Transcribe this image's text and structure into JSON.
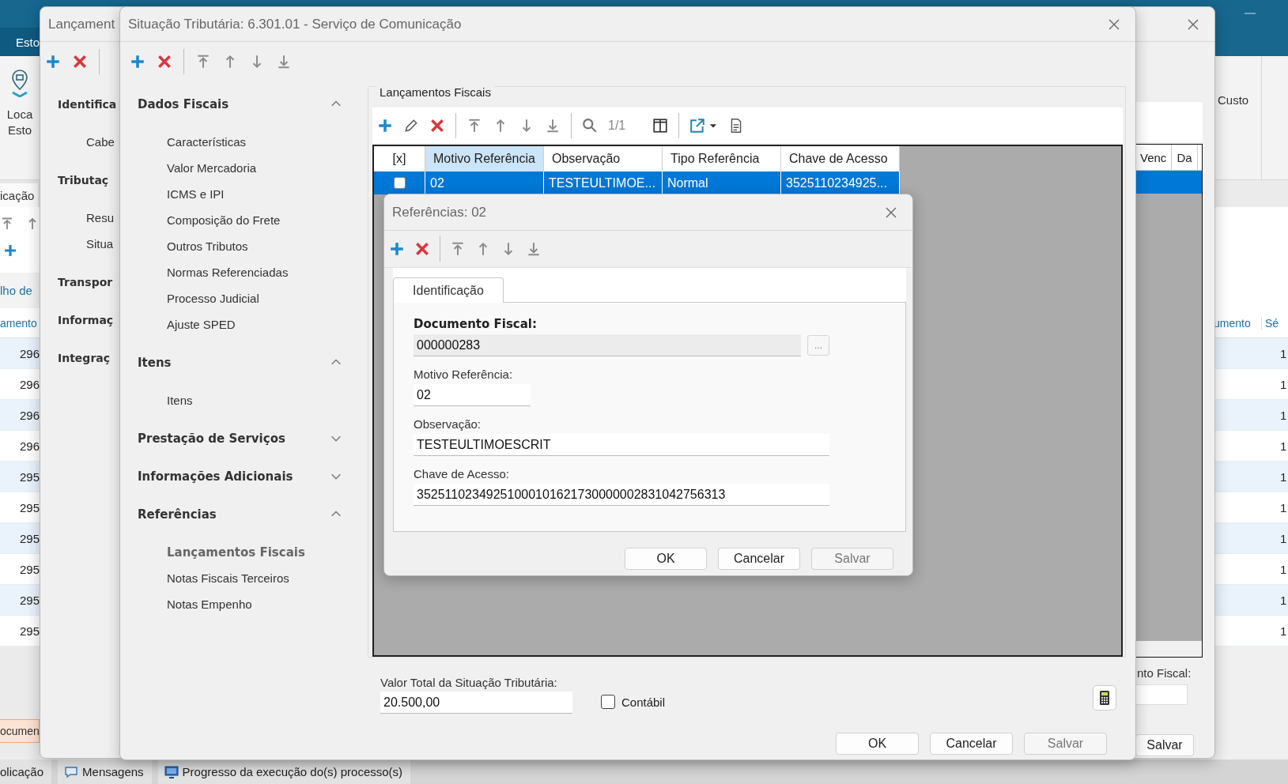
{
  "background_app": {
    "ribbon_tab": "Esto",
    "ribbon_button_lines": [
      "Loca",
      "Esto"
    ],
    "ribbon_right_label": "Custo",
    "left_tab": "icação",
    "left_link": "lho de",
    "left_column_header": "amento",
    "left_rows": [
      "296",
      "296",
      "296",
      "296",
      "295",
      "295",
      "295",
      "295",
      "295",
      "295"
    ],
    "left_badge": "ocumen",
    "right_column_headers": [
      "umento",
      "Sé"
    ],
    "right_rows": [
      "1",
      "1",
      "1",
      "1",
      "1",
      "1",
      "1",
      "1",
      "1",
      "1"
    ]
  },
  "window_back": {
    "title": "Lançament",
    "nav": [
      {
        "kind": "section",
        "label": "Identifica"
      },
      {
        "kind": "item",
        "label": "Cabe"
      },
      {
        "kind": "section",
        "label": "Tributaç"
      },
      {
        "kind": "item",
        "label": "Resu"
      },
      {
        "kind": "item",
        "label": "Situa"
      },
      {
        "kind": "section",
        "label": "Transpor"
      },
      {
        "kind": "section",
        "label": "Informaç"
      },
      {
        "kind": "section",
        "label": "Integraç"
      }
    ],
    "grid_columns": [
      "Venc",
      "Da"
    ],
    "grid_row": {
      "selected": true
    },
    "field_label": "nto Fiscal:",
    "button": "Salvar"
  },
  "window_main": {
    "title": "Situação Tributária: 6.301.01 - Serviço de Comunicação",
    "nav": [
      {
        "label": "Dados Fiscais",
        "expanded": true,
        "items": [
          {
            "label": "Características",
            "selected": false
          },
          {
            "label": "Valor Mercadoria",
            "selected": false
          },
          {
            "label": "ICMS e IPI",
            "selected": false
          },
          {
            "label": "Composição do Frete",
            "selected": false
          },
          {
            "label": "Outros Tributos",
            "selected": false
          },
          {
            "label": "Normas Referenciadas",
            "selected": false
          },
          {
            "label": "Processo Judicial",
            "selected": false
          },
          {
            "label": "Ajuste SPED",
            "selected": false
          }
        ]
      },
      {
        "label": "Itens",
        "expanded": true,
        "items": [
          {
            "label": "Itens",
            "selected": false
          }
        ]
      },
      {
        "label": "Prestação de Serviços",
        "expanded": false
      },
      {
        "label": "Informações Adicionais",
        "expanded": false
      },
      {
        "label": "Referências",
        "expanded": true,
        "items": [
          {
            "label": "Lançamentos Fiscais",
            "selected": true
          },
          {
            "label": "Notas Fiscais Terceiros",
            "selected": false
          },
          {
            "label": "Notas Empenho",
            "selected": false
          }
        ]
      }
    ],
    "group_title": "Lançamentos Fiscais",
    "pager": "1/1",
    "grid": {
      "columns": [
        {
          "label": "[x]",
          "selected": false
        },
        {
          "label": "Motivo Referência",
          "selected": true
        },
        {
          "label": "Observação",
          "selected": false
        },
        {
          "label": "Tipo Referência",
          "selected": false
        },
        {
          "label": "Chave de Acesso",
          "selected": false
        }
      ],
      "rows": [
        {
          "selected": true,
          "checked": false,
          "cells": [
            "",
            "02",
            "TESTEULTIMOE...",
            "Normal",
            "3525110234925..."
          ]
        }
      ]
    },
    "total": {
      "label": "Valor Total da Situação Tributária:",
      "value": "20.500,00"
    },
    "contabil": {
      "label": "Contábil",
      "checked": false
    },
    "buttons": [
      {
        "label": "OK",
        "disabled": false
      },
      {
        "label": "Cancelar",
        "disabled": false
      },
      {
        "label": "Salvar",
        "disabled": true
      }
    ]
  },
  "dialog": {
    "title": "Referências: 02",
    "tabs": [
      {
        "label": "Identificação",
        "selected": true
      }
    ],
    "fields": [
      {
        "kind": "lookup",
        "label": "Documento Fiscal:",
        "value": "000000283",
        "button": "..."
      },
      {
        "kind": "short",
        "label": "Motivo Referência:",
        "value": "02"
      },
      {
        "kind": "text",
        "label": "Observação:",
        "value": "TESTEULTIMOESCRIT"
      },
      {
        "kind": "text",
        "label": "Chave de Acesso:",
        "value": "35251102349251000101621730000002831042756313"
      }
    ],
    "buttons": [
      {
        "label": "OK",
        "disabled": false
      },
      {
        "label": "Cancelar",
        "disabled": false
      },
      {
        "label": "Salvar",
        "disabled": true
      }
    ]
  },
  "taskbar": [
    {
      "label": "olicação"
    },
    {
      "label": "Mensagens"
    },
    {
      "label": "Progresso da execução do(s) processo(s)"
    }
  ]
}
